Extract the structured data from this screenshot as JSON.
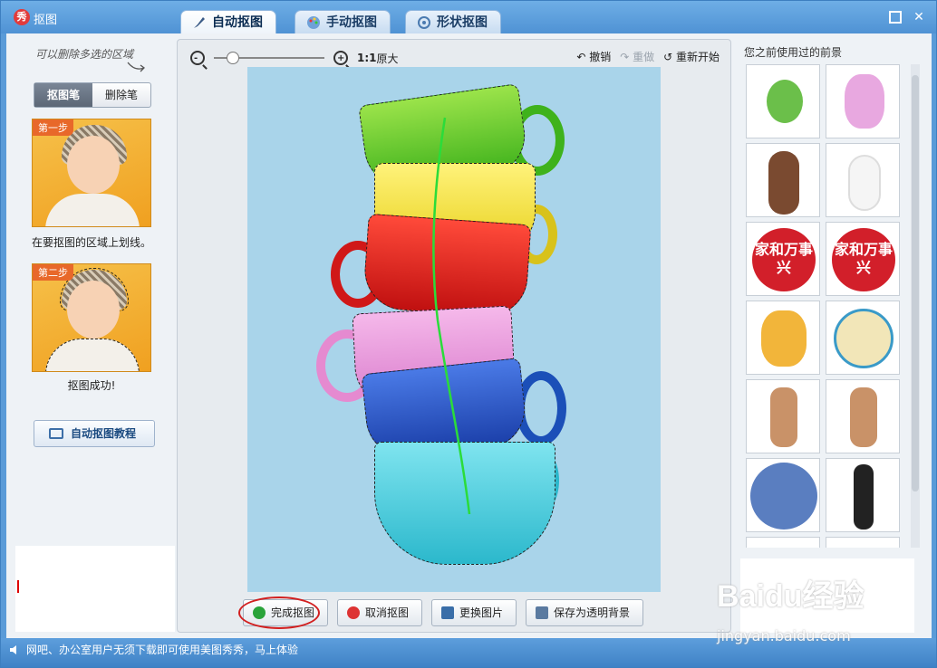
{
  "window": {
    "title": "抠图",
    "logo": "秀"
  },
  "tabs": [
    {
      "label": "自动抠图",
      "icon": "brush-icon",
      "active": true
    },
    {
      "label": "手动抠图",
      "icon": "palette-icon",
      "active": false
    },
    {
      "label": "形状抠图",
      "icon": "shapes-icon",
      "active": false
    }
  ],
  "left": {
    "hint": "可以删除多选的区域",
    "modes": [
      "抠图笔",
      "删除笔"
    ],
    "step1": {
      "tag": "第一步",
      "caption": "在要抠图的区域上划线。"
    },
    "step2": {
      "tag": "第二步",
      "caption": "抠图成功!"
    },
    "tutorial": "自动抠图教程"
  },
  "toolbar": {
    "zoom_ratio": "1:1",
    "original": "原大",
    "undo": "撤销",
    "redo": "重做",
    "restart": "重新开始"
  },
  "actions": {
    "finish": "完成抠图",
    "cancel": "取消抠图",
    "replace": "更换图片",
    "save_transparent": "保存为透明背景"
  },
  "right": {
    "title": "您之前使用过的前景",
    "stamp_text": "家和万事兴"
  },
  "status": {
    "text": "网吧、办公室用户无须下载即可使用美图秀秀，马上体验"
  },
  "watermark": {
    "brand": "Baidu经验",
    "url": "jingyan.baidu.com"
  },
  "colors": {
    "accent": "#4f92d4",
    "canvas_bg": "#a9d4ea",
    "stroke": "#2bdc3a"
  }
}
